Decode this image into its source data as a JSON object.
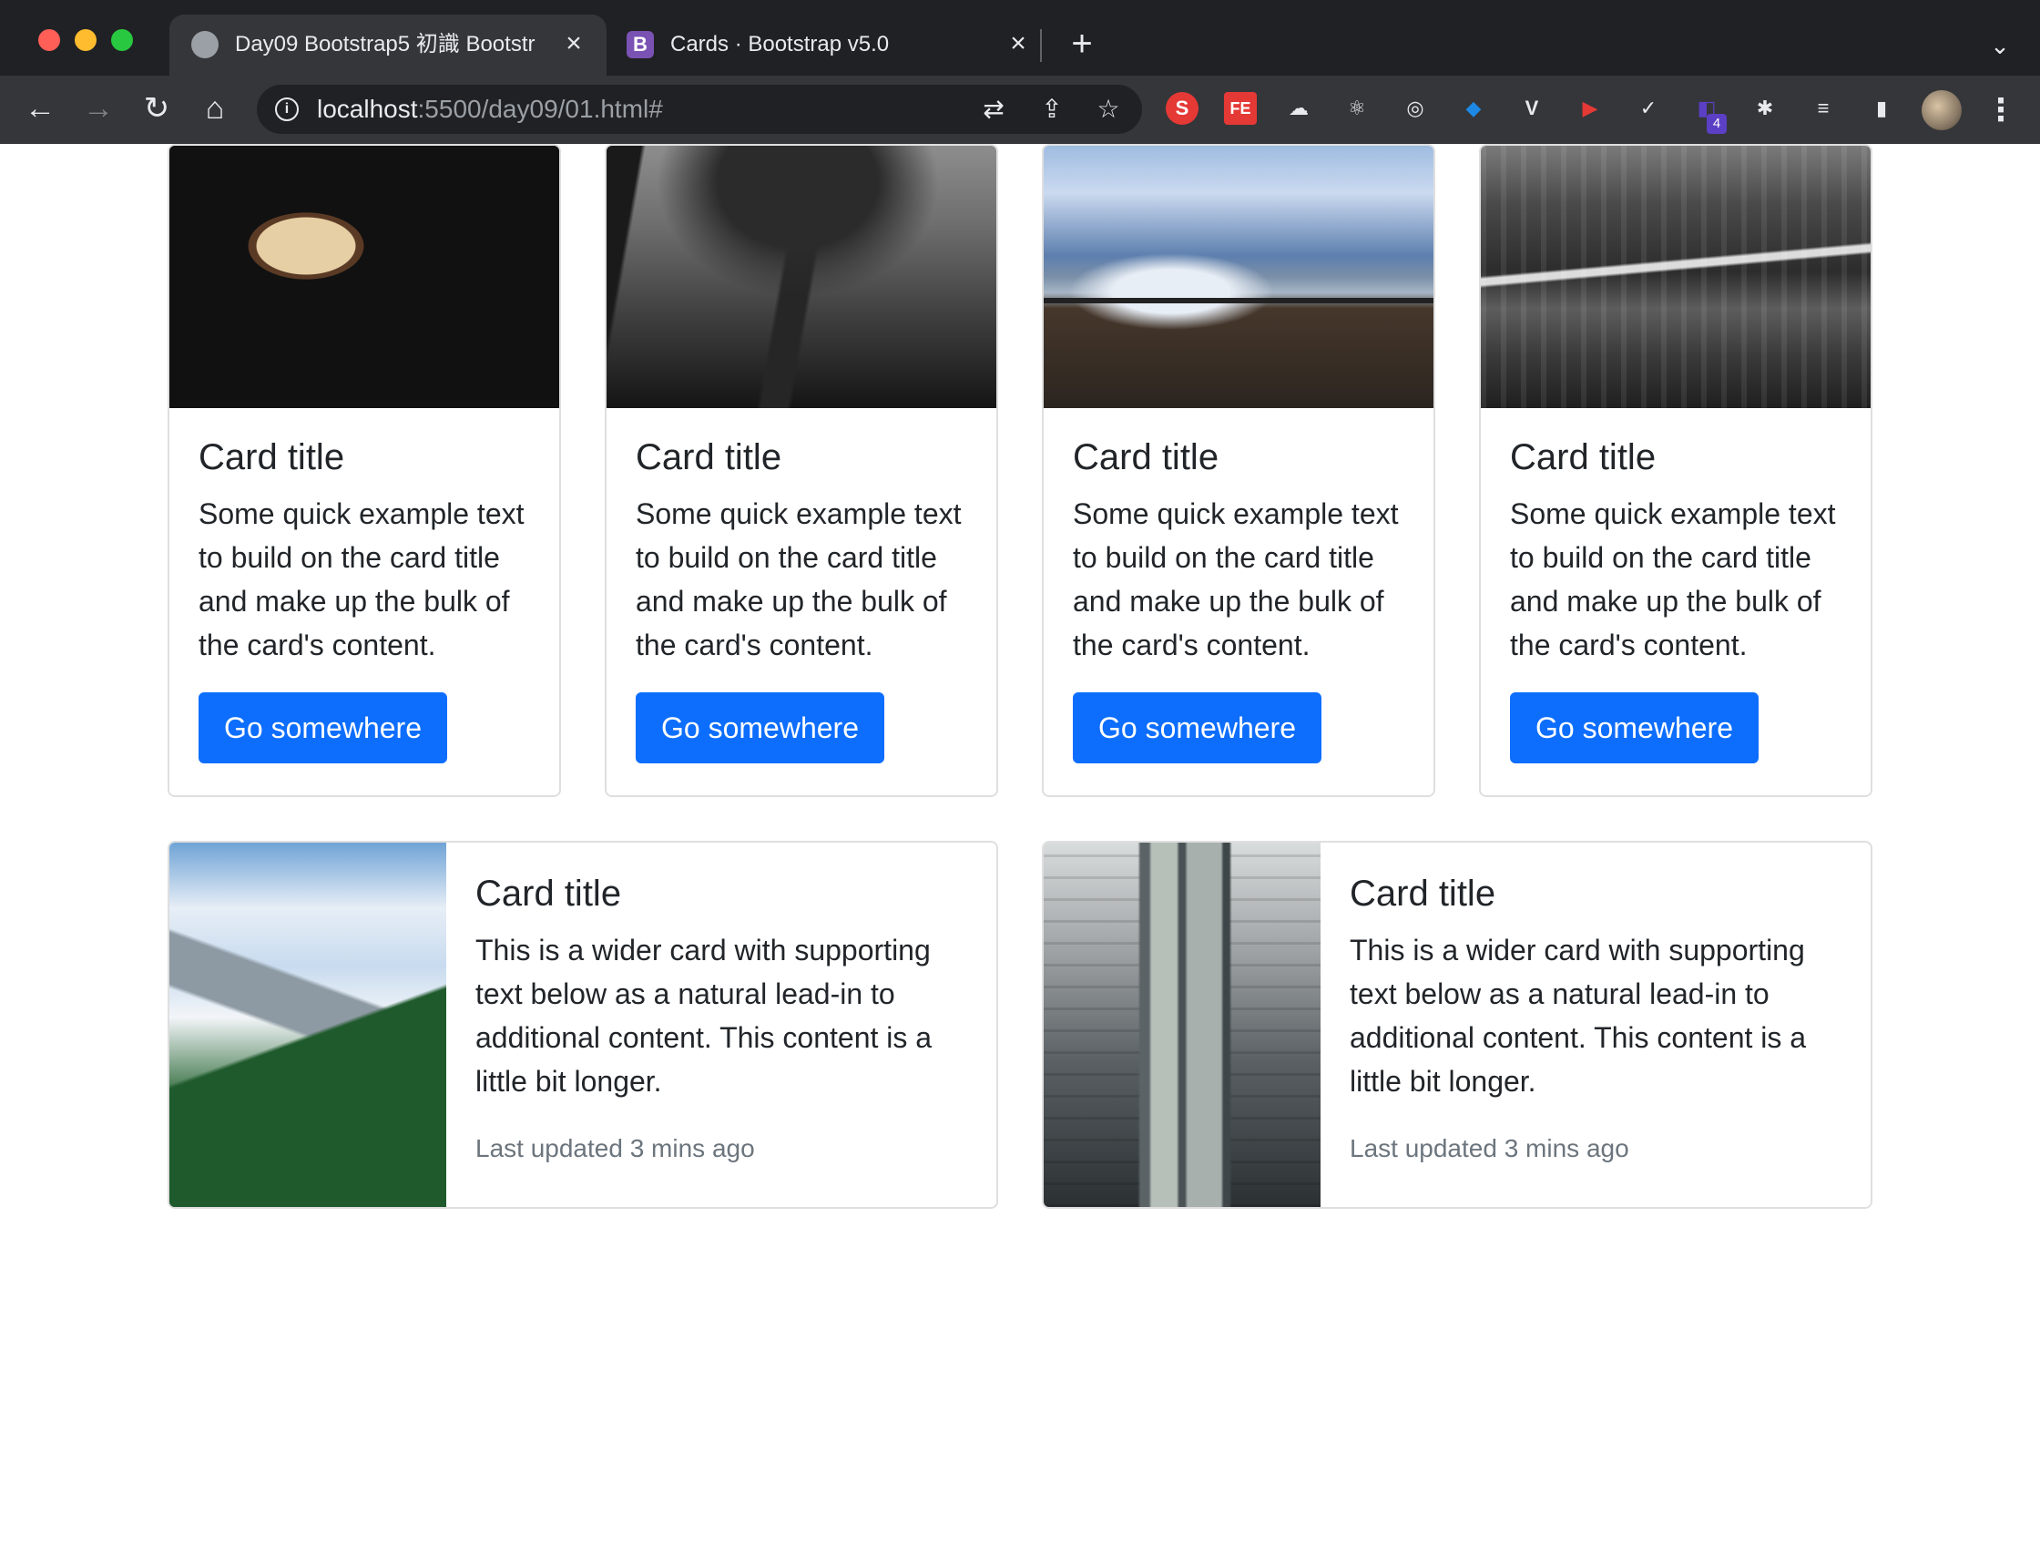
{
  "browser": {
    "tabs": [
      {
        "title": "Day09 Bootstrap5 初識 Bootstr",
        "favicon": "globe-icon",
        "active": true
      },
      {
        "title": "Cards · Bootstrap v5.0",
        "favicon": "bootstrap-icon",
        "favicon_letter": "B",
        "active": false
      }
    ],
    "url_host": "localhost",
    "url_path": ":5500/day09/01.html#",
    "extension_badge": "4",
    "extensions": [
      {
        "name": "s-extension-icon",
        "label": "S",
        "color": "#e53935"
      },
      {
        "name": "fe-extension-icon",
        "label": "FE",
        "color": "#e53935"
      },
      {
        "name": "cloud-extension-icon",
        "label": "☁",
        "color": "#5f6368"
      },
      {
        "name": "react-devtools-icon",
        "label": "⚛",
        "color": "#5f6368"
      },
      {
        "name": "target-extension-icon",
        "label": "◎",
        "color": "#5f6368"
      },
      {
        "name": "gem-extension-icon",
        "label": "◆",
        "color": "#1e88e5"
      },
      {
        "name": "vue-devtools-icon",
        "label": "V",
        "color": "#5f6368"
      },
      {
        "name": "youtube-extension-icon",
        "label": "▶",
        "color": "#e53935"
      },
      {
        "name": "check-extension-icon",
        "label": "✓",
        "color": "#5f6368"
      },
      {
        "name": "cube-extension-icon",
        "label": "◧",
        "color": "#5b3fc4"
      }
    ]
  },
  "cards": [
    {
      "title": "Card title",
      "text": "Some quick example text to build on the card title and make up the bulk of the card's content.",
      "button": "Go somewhere",
      "image": "coffee-cup-image"
    },
    {
      "title": "Card title",
      "text": "Some quick example text to build on the card title and make up the bulk of the card's content.",
      "button": "Go somewhere",
      "image": "misty-trees-image"
    },
    {
      "title": "Card title",
      "text": "Some quick example text to build on the card title and make up the bulk of the card's content.",
      "button": "Go somewhere",
      "image": "lakeside-bicycle-image"
    },
    {
      "title": "Card title",
      "text": "Some quick example text to build on the card title and make up the bulk of the card's content.",
      "button": "Go somewhere",
      "image": "city-bridge-night-image"
    }
  ],
  "horizontal_cards": [
    {
      "title": "Card title",
      "text": "This is a wider card with supporting text below as a natural lead-in to additional content. This content is a little bit longer.",
      "updated": "Last updated 3 mins ago",
      "image": "mountain-forest-image"
    },
    {
      "title": "Card title",
      "text": "This is a wider card with supporting text below as a natural lead-in to additional content. This content is a little bit longer.",
      "updated": "Last updated 3 mins ago",
      "image": "skyscraper-image"
    }
  ],
  "colors": {
    "primary": "#0d6efd",
    "muted": "#6c757d",
    "chrome_dark": "#202124",
    "chrome_toolbar": "#35363a"
  }
}
